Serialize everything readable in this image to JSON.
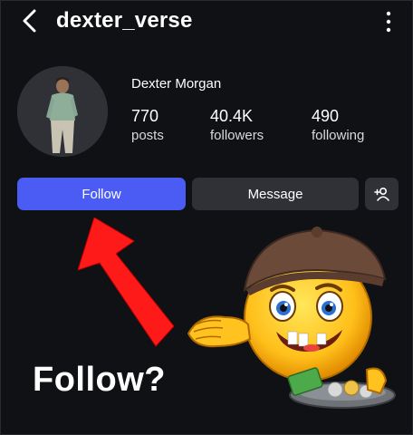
{
  "header": {
    "username": "dexter_verse",
    "back_icon": "chevron-left-icon",
    "more_icon": "more-vertical-icon"
  },
  "profile": {
    "display_name": "Dexter Morgan",
    "stats": [
      {
        "value": "770",
        "label": "posts"
      },
      {
        "value": "40.4K",
        "label": "followers"
      },
      {
        "value": "490",
        "label": "following"
      }
    ]
  },
  "actions": {
    "follow_label": "Follow",
    "message_label": "Message",
    "add_user_icon": "add-user-icon"
  },
  "overlay": {
    "caption": "Follow?",
    "arrow_color": "#ff1a1a",
    "emoji": "begging-emoji"
  },
  "colors": {
    "background": "#101114",
    "follow_button": "#4b5cf5",
    "secondary_button": "#2f3136"
  }
}
